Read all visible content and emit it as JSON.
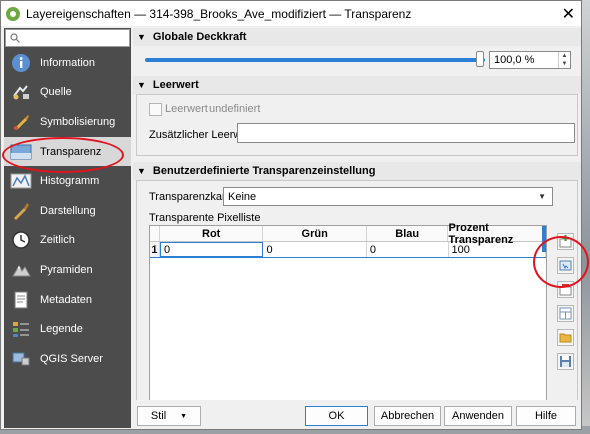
{
  "window": {
    "title": "Layereigenschaften — 314-398_Brooks_Ave_modifiziert — Transparenz",
    "close_glyph": "✕"
  },
  "sidebar": {
    "search_placeholder": "",
    "items": [
      {
        "label": "Information",
        "icon": "info-icon"
      },
      {
        "label": "Quelle",
        "icon": "source-icon"
      },
      {
        "label": "Symbolisierung",
        "icon": "symbology-icon"
      },
      {
        "label": "Transparenz",
        "icon": "transparency-icon",
        "active": true
      },
      {
        "label": "Histogramm",
        "icon": "histogram-icon"
      },
      {
        "label": "Darstellung",
        "icon": "rendering-icon"
      },
      {
        "label": "Zeitlich",
        "icon": "clock-icon"
      },
      {
        "label": "Pyramiden",
        "icon": "pyramid-icon"
      },
      {
        "label": "Metadaten",
        "icon": "metadata-icon"
      },
      {
        "label": "Legende",
        "icon": "legend-icon"
      },
      {
        "label": "QGIS Server",
        "icon": "server-icon"
      }
    ]
  },
  "opacity": {
    "title": "Globale Deckkraft",
    "value_text": "100,0 %",
    "value": 100
  },
  "nodata": {
    "title": "Leerwert",
    "checkbox_label": "Leerwert",
    "undefined_text": "undefiniert",
    "additional_label": "Zusätzlicher Leerwert",
    "additional_value": ""
  },
  "custom": {
    "title": "Benutzerdefinierte Transparenzeinstellung",
    "band_label": "Transparenzkanal",
    "band_value": "Keine",
    "pixel_list_label": "Transparente Pixelliste",
    "columns": [
      "Rot",
      "Grün",
      "Blau",
      "Prozent Transparenz"
    ],
    "rows": [
      {
        "index": "1",
        "cells": [
          "0",
          "0",
          "0",
          "100"
        ]
      }
    ]
  },
  "footer": {
    "style_label": "Stil",
    "ok_label": "OK",
    "cancel_label": "Abbrechen",
    "apply_label": "Anwenden",
    "help_label": "Hilfe"
  },
  "colors": {
    "accent": "#2b80d6",
    "annotation_red": "#e0141e",
    "sidebar_bg": "#4c4c4c"
  }
}
